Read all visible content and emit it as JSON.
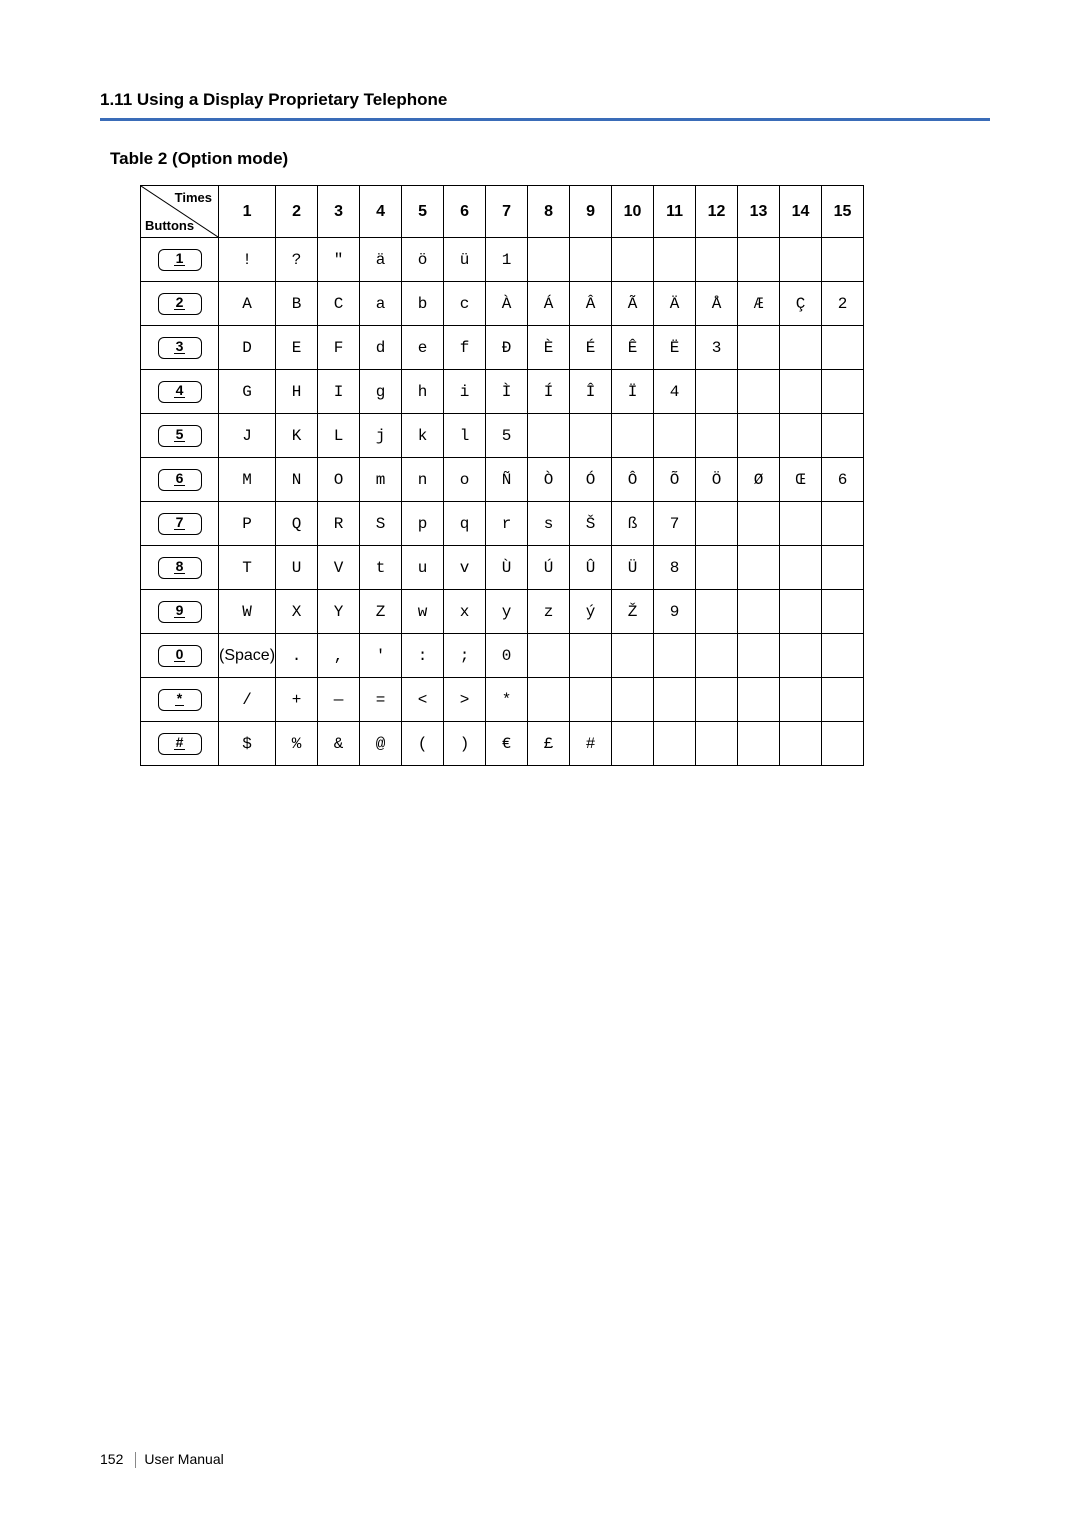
{
  "section_header": "1.11 Using a Display Proprietary Telephone",
  "table_caption": "Table 2 (Option mode)",
  "corner": {
    "top": "Times",
    "bottom": "Buttons"
  },
  "columns": [
    "1",
    "2",
    "3",
    "4",
    "5",
    "6",
    "7",
    "8",
    "9",
    "10",
    "11",
    "12",
    "13",
    "14",
    "15"
  ],
  "rows": [
    {
      "key": "1",
      "cells": [
        "!",
        "?",
        "\"",
        "ä",
        "ö",
        "ü",
        "1",
        "",
        "",
        "",
        "",
        "",
        "",
        "",
        ""
      ]
    },
    {
      "key": "2",
      "cells": [
        "A",
        "B",
        "C",
        "a",
        "b",
        "c",
        "À",
        "Á",
        "Â",
        "Ã",
        "Ä",
        "Å",
        "Æ",
        "Ç",
        "2"
      ]
    },
    {
      "key": "3",
      "cells": [
        "D",
        "E",
        "F",
        "d",
        "e",
        "f",
        "Ð",
        "È",
        "É",
        "Ê",
        "Ë",
        "3",
        "",
        "",
        ""
      ]
    },
    {
      "key": "4",
      "cells": [
        "G",
        "H",
        "I",
        "g",
        "h",
        "i",
        "Ì",
        "Í",
        "Î",
        "Ï",
        "4",
        "",
        "",
        "",
        ""
      ]
    },
    {
      "key": "5",
      "cells": [
        "J",
        "K",
        "L",
        "j",
        "k",
        "l",
        "5",
        "",
        "",
        "",
        "",
        "",
        "",
        "",
        ""
      ]
    },
    {
      "key": "6",
      "cells": [
        "M",
        "N",
        "O",
        "m",
        "n",
        "o",
        "Ñ",
        "Ò",
        "Ó",
        "Ô",
        "Õ",
        "Ö",
        "Ø",
        "Œ",
        "6"
      ]
    },
    {
      "key": "7",
      "cells": [
        "P",
        "Q",
        "R",
        "S",
        "p",
        "q",
        "r",
        "s",
        "Š",
        "ß",
        "7",
        "",
        "",
        "",
        ""
      ]
    },
    {
      "key": "8",
      "cells": [
        "T",
        "U",
        "V",
        "t",
        "u",
        "v",
        "Ù",
        "Ú",
        "Û",
        "Ü",
        "8",
        "",
        "",
        "",
        ""
      ]
    },
    {
      "key": "9",
      "cells": [
        "W",
        "X",
        "Y",
        "Z",
        "w",
        "x",
        "y",
        "z",
        "ý",
        "Ž",
        "9",
        "",
        "",
        "",
        ""
      ]
    },
    {
      "key": "0",
      "cells": [
        "(Space)",
        ".",
        ",",
        "'",
        ":",
        ";",
        "0",
        "",
        "",
        "",
        "",
        "",
        "",
        "",
        ""
      ]
    },
    {
      "key": "*",
      "cells": [
        "/",
        "+",
        "—",
        "=",
        "<",
        ">",
        "*",
        "",
        "",
        "",
        "",
        "",
        "",
        "",
        ""
      ]
    },
    {
      "key": "#",
      "cells": [
        "$",
        "%",
        "&",
        "@",
        "(",
        ")",
        "€",
        "£",
        "#",
        "",
        "",
        "",
        "",
        "",
        ""
      ]
    }
  ],
  "footer": {
    "page": "152",
    "label": "User Manual"
  }
}
